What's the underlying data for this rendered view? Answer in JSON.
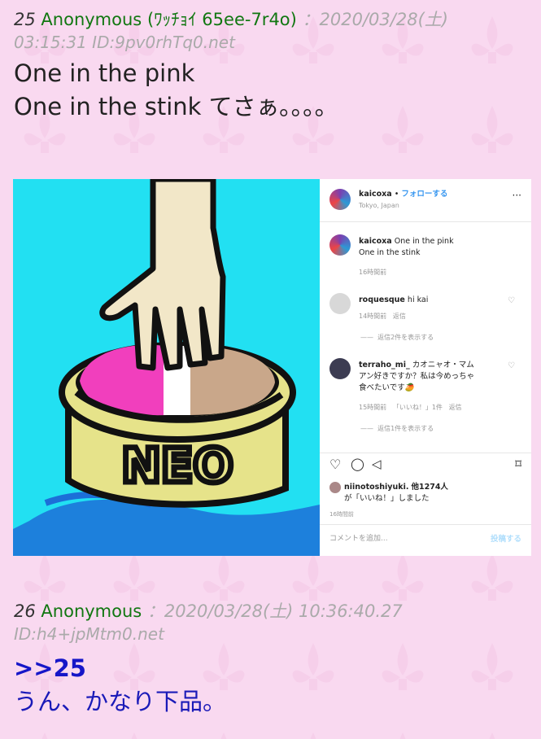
{
  "post25": {
    "number": "25",
    "name": "Anonymous",
    "name_suffix": "(ﾜｯﾁｮｲ 65ee-7r4o)",
    "datetime": "：2020/03/28(土)",
    "time_id": "03:15:31 ID:9pv0rhTq0.net",
    "lines": [
      "One in the pink",
      "One in the stink てさぁ。。。。"
    ]
  },
  "image": {
    "drawing_label": "NEO",
    "ig": {
      "username": "kaicoxa",
      "follow": "フォローする",
      "dot": "•",
      "location": "Tokyo, Japan",
      "more": "···",
      "caption_user": "kaicoxa",
      "caption_line1": "One in the pink",
      "caption_line2": "One in the stink",
      "caption_time": "16時間前",
      "c1_user": "roquesque",
      "c1_text": "hi kai",
      "c1_time": "14時間前",
      "c1_reply": "返信",
      "c1_more": "返信2件を表示する",
      "c2_user": "terraho_mi_",
      "c2_text1": "カオニャオ・マム",
      "c2_text2": "アン好きですか？私は今めっちゃ",
      "c2_text3": "食べたいです🥭",
      "c2_time": "15時間前",
      "c2_likes": "「いいね！」1件",
      "c2_reply": "返信",
      "c2_more": "返信1件を表示する",
      "likes_user": "niinotoshiyuki.",
      "likes_rest": "他1274人",
      "likes_line2": "が「いいね！」しました",
      "post_time": "16時間前",
      "comment_placeholder": "コメントを追加...",
      "post_button": "投稿する",
      "colors": {
        "link": "#3897f0",
        "heart": "#999999"
      }
    }
  },
  "post26": {
    "number": "26",
    "name": "Anonymous",
    "datetime": "：2020/03/28(土) 10:36:40.27",
    "id": "ID:h4+jpMtm0.net",
    "anchor": ">>25",
    "body": "うん、かなり下品。"
  },
  "colors": {
    "background": "#f9d9f0",
    "name_green": "#117711",
    "anchor_blue": "#1616c8",
    "cyan": "#22e0f2"
  }
}
